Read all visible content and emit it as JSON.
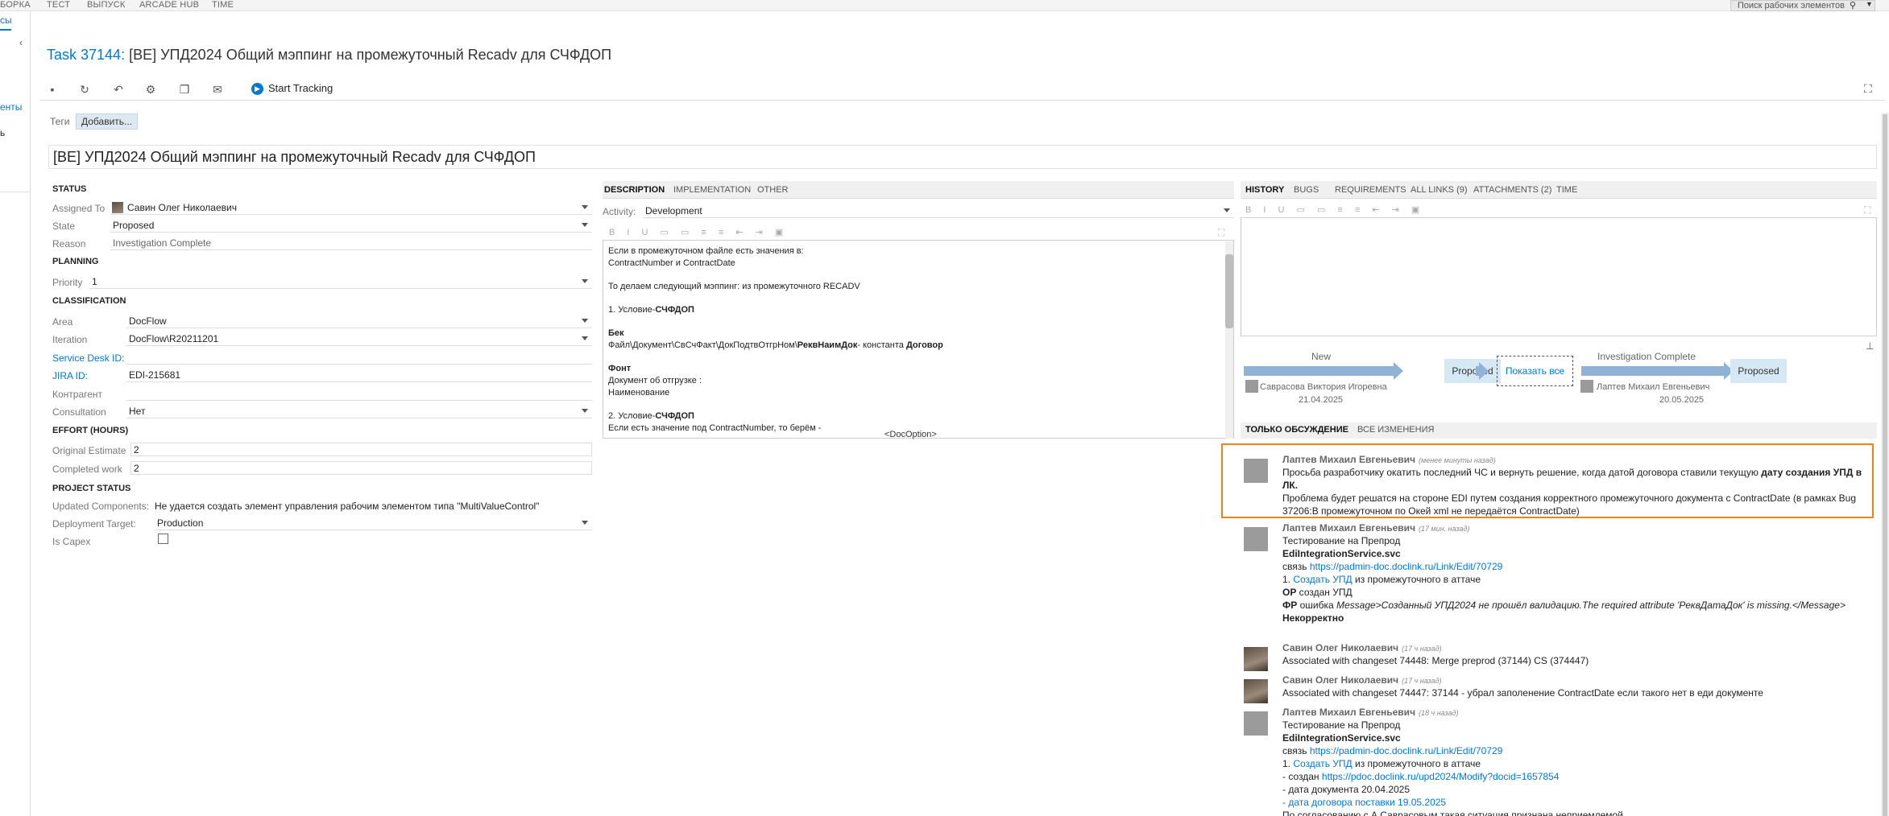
{
  "topnav": {
    "items": [
      "БОРКА",
      "ТЕСТ",
      "ВЫПУСК",
      "ARCADE HUB",
      "TIME"
    ],
    "search_placeholder": "Поиск рабочих элементов"
  },
  "leftrail": {
    "links": [
      "сы",
      "енты",
      "ь"
    ]
  },
  "task": {
    "id_label": "Task 37144:",
    "title": "[BE] УПД2024 Общий мэппинг на промежуточный Recadv для СЧФДОП",
    "title_field": "[BE] УПД2024  Общий мэппинг на промежуточный Recadv для СЧФДОП"
  },
  "toolbar": {
    "start_tracking": "Start Tracking"
  },
  "tags": {
    "label": "Теги",
    "add": "Добавить..."
  },
  "status": {
    "section": "STATUS",
    "assigned_to_label": "Assigned To",
    "assigned_to": "Савин Олег Николаевич",
    "state_label": "State",
    "state": "Proposed",
    "reason_label": "Reason",
    "reason": "Investigation Complete"
  },
  "planning": {
    "section": "PLANNING",
    "priority_label": "Priority",
    "priority": "1"
  },
  "classification": {
    "section": "CLASSIFICATION",
    "area_label": "Area",
    "area": "DocFlow",
    "iteration_label": "Iteration",
    "iteration": "DocFlow\\R20211201",
    "service_desk_label": "Service Desk ID:",
    "service_desk": "",
    "jira_label": "JIRA ID:",
    "jira": "EDI-215681",
    "contractor_label": "Контрагент",
    "contractor": "",
    "consultation_label": "Consultation",
    "consultation": "Нет"
  },
  "effort": {
    "section": "EFFORT (HOURS)",
    "original_label": "Original Estimate",
    "original": "2",
    "completed_label": "Completed work",
    "completed": "2"
  },
  "project_status": {
    "section": "PROJECT STATUS",
    "updated_label": "Updated Components:",
    "updated": "Не удается создать элемент управления рабочим элементом типа \"MultiValueControl\"",
    "deployment_label": "Deployment Target:",
    "deployment": "Production",
    "capex_label": "Is Capex",
    "capex": false
  },
  "desc_tabs": [
    "DESCRIPTION",
    "IMPLEMENTATION",
    "OTHER"
  ],
  "activity": {
    "label": "Activity:",
    "value": "Development"
  },
  "description": {
    "l1": "Если в промежуточном файле есть значения в:",
    "l2": "ContractNumber и ContractDate",
    "l3": "То  делаем следующий мэппинг: из промежуточного RECADV",
    "l4a": "1. Условие-",
    "l4b": "СЧФДОП",
    "l5": "Бек",
    "l6a": "Файл\\Документ\\СвСчФакт\\ДокПодтвОтгрНом\\",
    "l6b": "РеквНаимДок",
    "l6c": "- константа ",
    "l6d": "Договор",
    "l7": "Фонт",
    "l8": "Документ об отгрузке :",
    "l9": "Наименование",
    "l10a": "2. Условие-",
    "l10b": "СЧФДОП",
    "l11": " Если есть значение под ContractNumber, то берём -",
    "docoption": "<DocOption>"
  },
  "hist_tabs": [
    "HISTORY",
    "BUGS",
    "REQUIREMENTS",
    "ALL LINKS (9)",
    "ATTACHMENTS (2)",
    "TIME"
  ],
  "workflow": {
    "t1": "New",
    "s1": "Proposed",
    "show_all": "Показать все",
    "t2": "Investigation Complete",
    "s2": "Proposed",
    "p1": "Саврасова Виктория Игоревна",
    "d1": "21.04.2025",
    "p2": "Лаптев Михаил Евгеньевич",
    "d2": "20.05.2025"
  },
  "comment_tabs": [
    "ТОЛЬКО ОБСУЖДЕНИЕ",
    "ВСЕ ИЗМЕНЕНИЯ"
  ],
  "comments": {
    "c1": {
      "author": "Лаптев Михаил Евгеньевич",
      "time": "(менее минуты назад)",
      "l1a": "Просьба разработчику  окатить последний ЧС и вернуть решение, когда датой договора  ставили текущую ",
      "l1b": "дату создания УПД в",
      "l2": "ЛК.",
      "l3": "Проблема будет решатся на стороне EDI путем создания корректного промежуточного документа с ContractDate (в рамках Bug",
      "l4": "37206:В промежуточном по Окей xml не передаётся ContractDate)"
    },
    "c2": {
      "author": "Лаптев Михаил Евгеньевич",
      "time": "(17 мин. назад)",
      "l1": "Тестирование на Препрод",
      "l2": "EdiIntegrationService.svc",
      "l3a": "связь ",
      "l3b": "https://padmin-doc.doclink.ru/Link/Edit/70729",
      "l4a": "1. ",
      "l4b": "Создать УПД",
      "l4c": " из промежуточного в аттаче",
      "l5a": "ОР",
      "l5b": " создан УПД",
      "l6a": "ФР",
      "l6b": " ошибка ",
      "l6c": "Message>Созданный УПД2024 не прошёл валидацию.The required attribute 'РеквДатаДок' is missing.</Message>",
      "l7": "Некорректно"
    },
    "c3": {
      "author": "Савин Олег Николаевич",
      "time": "(17 ч назад)",
      "l1": "Associated with changeset 74448: Merge preprod (37144) CS (374447)"
    },
    "c4": {
      "author": "Савин Олег Николаевич",
      "time": "(17 ч назад)",
      "l1": "Associated with changeset 74447: 37144 - убрал заполенение ContractDate если такого нет в еди документе"
    },
    "c5": {
      "author": "Лаптев Михаил Евгеньевич",
      "time": "(18 ч назад)",
      "l1": "Тестирование на Препрод",
      "l2": "EdiIntegrationService.svc",
      "l3a": "связь ",
      "l3b": "https://padmin-doc.doclink.ru/Link/Edit/70729",
      "l4a": "1. ",
      "l4b": "Создать УПД",
      "l4c": " из промежуточного в аттаче",
      "l5a": "- создан ",
      "l5b": "https://pdoc.doclink.ru/upd2024/Modify?docid=1657854",
      "l6": "- дата документа 20.04.2025",
      "l7": "- дата договора поставки 19.05.2025",
      "l8": "По согласованию с А.Саврасовым такая ситуация признана неприемлемой"
    }
  }
}
